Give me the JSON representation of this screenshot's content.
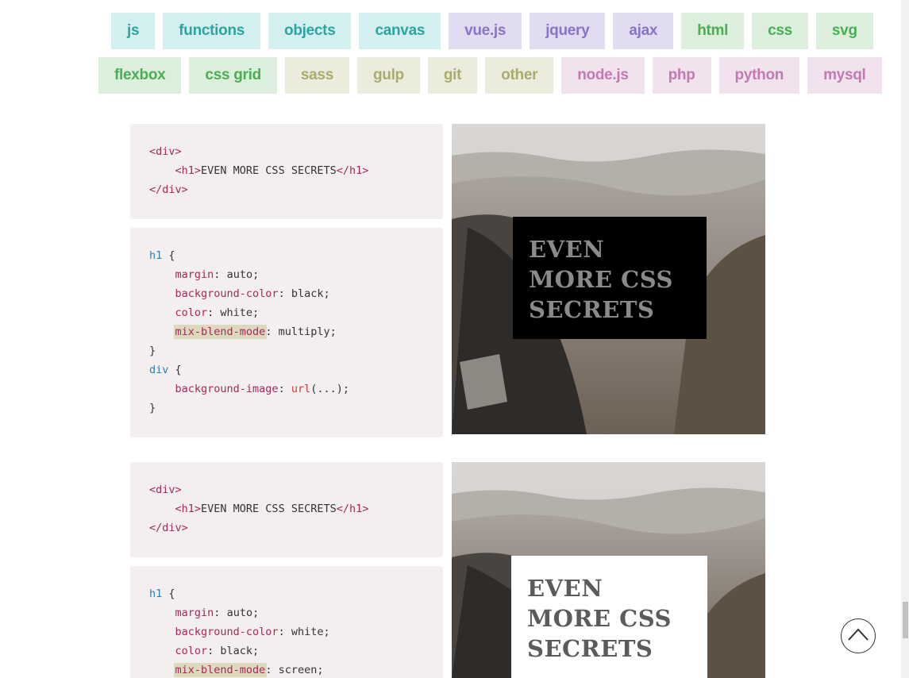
{
  "tags": {
    "row1": [
      {
        "label": "js",
        "color": "teal"
      },
      {
        "label": "functions",
        "color": "teal"
      },
      {
        "label": "objects",
        "color": "teal"
      },
      {
        "label": "canvas",
        "color": "teal"
      },
      {
        "label": "vue.js",
        "color": "purple"
      },
      {
        "label": "jquery",
        "color": "purple"
      },
      {
        "label": "ajax",
        "color": "purple"
      },
      {
        "label": "html",
        "color": "green"
      },
      {
        "label": "css",
        "color": "green"
      },
      {
        "label": "svg",
        "color": "green"
      }
    ],
    "row2": [
      {
        "label": "flexbox",
        "color": "green"
      },
      {
        "label": "css grid",
        "color": "green"
      },
      {
        "label": "sass",
        "color": "olive"
      },
      {
        "label": "gulp",
        "color": "olive"
      },
      {
        "label": "git",
        "color": "olive"
      },
      {
        "label": "other",
        "color": "olive"
      },
      {
        "label": "node.js",
        "color": "pink"
      },
      {
        "label": "php",
        "color": "pink"
      },
      {
        "label": "python",
        "color": "pink"
      },
      {
        "label": "mysql",
        "color": "pink"
      }
    ]
  },
  "examples": [
    {
      "html_code": {
        "open_div": "<div>",
        "h1_open": "<h1>",
        "h1_text": "EVEN MORE CSS SECRETS",
        "h1_close": "</h1>",
        "close_div": "</div>"
      },
      "css_code": {
        "h1_selector": "h1",
        "margin_prop": "margin",
        "margin_val": "auto;",
        "bg_prop": "background-color",
        "bg_val": "black;",
        "color_prop": "color",
        "color_val": "white;",
        "blend_prop": "mix-blend-mode",
        "blend_val": "multiply;",
        "div_selector": "div",
        "bgimg_prop": "background-image",
        "bgimg_fn": "url",
        "bgimg_arg": "(...);"
      },
      "demo_text": "EVEN MORE CSS SECRETS"
    },
    {
      "html_code": {
        "open_div": "<div>",
        "h1_open": "<h1>",
        "h1_text": "EVEN MORE CSS SECRETS",
        "h1_close": "</h1>",
        "close_div": "</div>"
      },
      "css_code": {
        "h1_selector": "h1",
        "margin_prop": "margin",
        "margin_val": "auto;",
        "bg_prop": "background-color",
        "bg_val": "white;",
        "color_prop": "color",
        "color_val": "black;",
        "blend_prop": "mix-blend-mode",
        "blend_val": "screen;"
      },
      "demo_text": "EVEN MORE CSS SECRETS"
    }
  ],
  "icons": {
    "scroll_top": "chevron-up-icon"
  }
}
